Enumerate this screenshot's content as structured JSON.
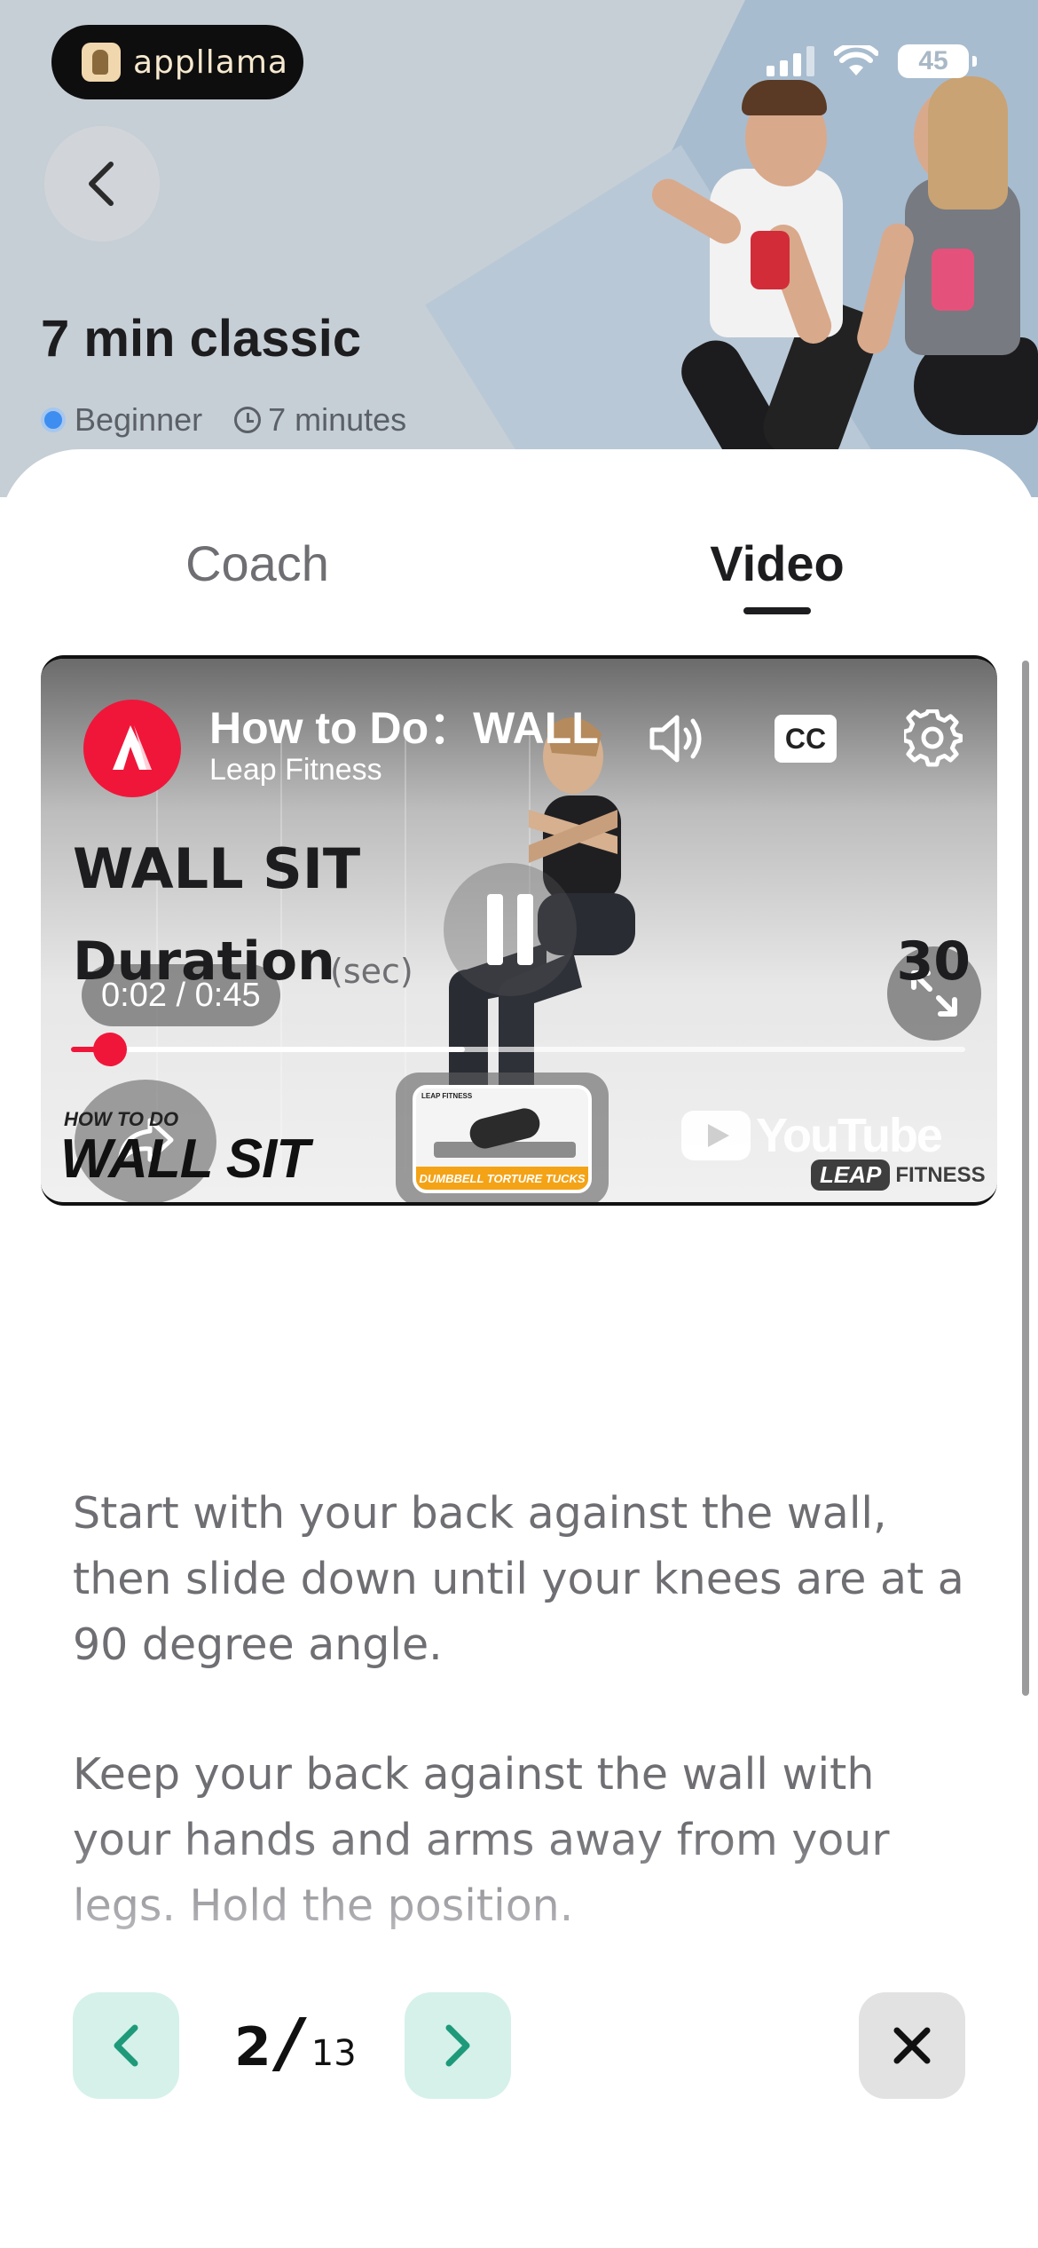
{
  "app": {
    "logo_text": "appllama"
  },
  "status_bar": {
    "battery": "45"
  },
  "header": {
    "title": "7 min classic",
    "level": "Beginner",
    "duration": "7 minutes"
  },
  "tabs": [
    {
      "label": "Coach",
      "active": false
    },
    {
      "label": "Video",
      "active": true
    }
  ],
  "video": {
    "title": "How to Do：WALL SIT",
    "channel": "Leap Fitness",
    "time_display": "0:02 / 0:45",
    "progress_fraction": 0.044,
    "buffer_fraction": 0.44,
    "overlay_small": "HOW TO DO",
    "overlay_big": "WALL SIT",
    "up_next_label": "DUMBBELL TORTURE TUCKS",
    "up_next_brand": "LEAP FITNESS",
    "youtube_word": "YouTube",
    "brand_box": "LEAP",
    "brand_word": "FITNESS",
    "cc_label": "CC",
    "accent_color": "#f0163a"
  },
  "exercise": {
    "name": "WALL SIT",
    "duration_label": "Duration",
    "duration_unit": "(sec)",
    "duration_value": "30",
    "description_1": "Start with your back against the wall, then slide down until your knees are at a 90 degree angle.",
    "description_2": "Keep your back against the wall with your hands and arms away from your legs. Hold the position."
  },
  "pager": {
    "current": "2",
    "separator": "/",
    "total": "13"
  },
  "icons": [
    "back-arrow-icon",
    "speaker-icon",
    "cc-icon",
    "gear-icon",
    "pause-icon",
    "expand-icon",
    "share-icon",
    "chevron-left-icon",
    "chevron-right-icon",
    "close-icon",
    "clock-icon",
    "signal-icon",
    "wifi-icon",
    "battery-icon"
  ]
}
